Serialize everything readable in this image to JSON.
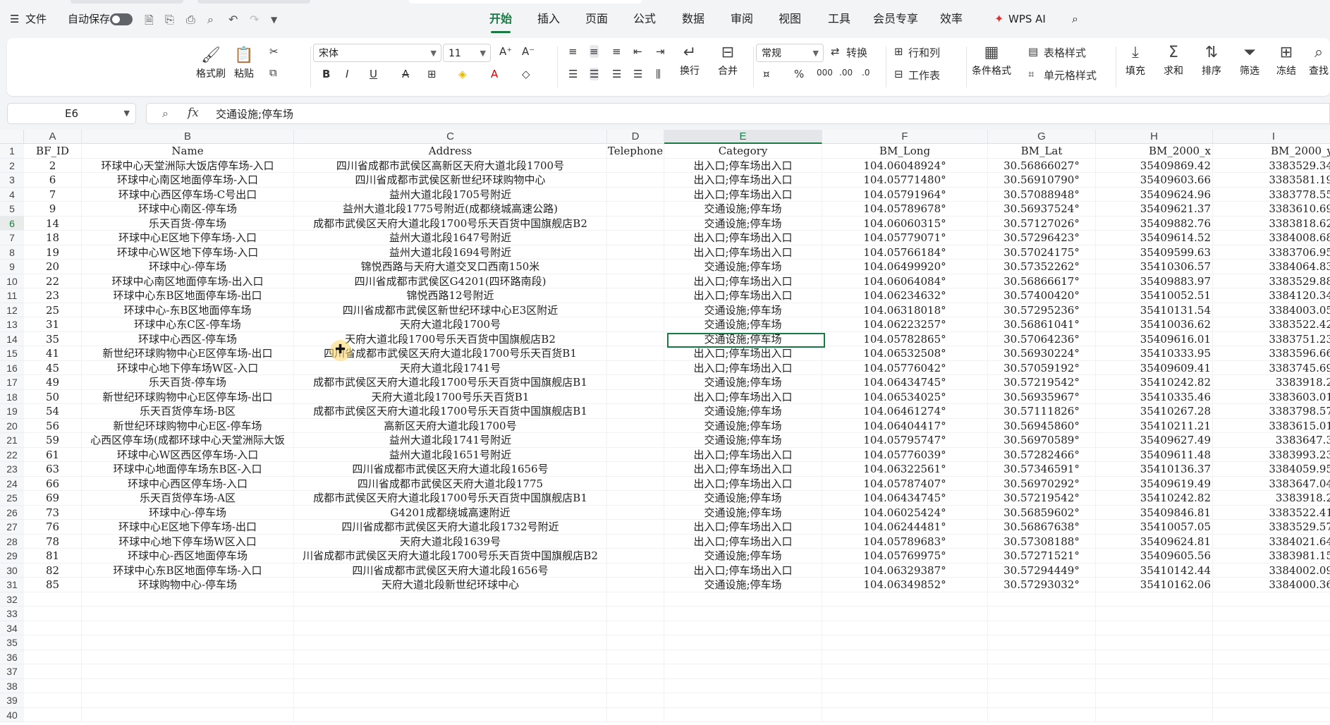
{
  "menubar": {
    "menu_label": "文件",
    "autosave_label": "自动保存",
    "tabs": [
      "开始",
      "插入",
      "页面",
      "公式",
      "数据",
      "审阅",
      "视图",
      "工具",
      "会员专享",
      "效率"
    ],
    "active_tab": "开始",
    "wps_ai": "WPS AI"
  },
  "ribbon": {
    "format_painter": "格式刷",
    "paste": "粘贴",
    "font_name": "宋体",
    "font_size": "11",
    "number_format": "常规",
    "convert": "转换",
    "rows_cols": "行和列",
    "worksheet": "工作表",
    "wrap": "换行",
    "merge": "合并",
    "conditional_format": "条件格式",
    "table_style": "表格样式",
    "cell_style": "单元格样式",
    "fill": "填充",
    "sum": "求和",
    "sort": "排序",
    "filter": "筛选",
    "freeze": "冻结",
    "find": "查找",
    "bold": "B",
    "italic": "I",
    "underline": "U",
    "percent": "%"
  },
  "formula_bar": {
    "cell_ref": "E6",
    "fx": "fx",
    "value": "交通设施;停车场"
  },
  "columns": [
    "A",
    "B",
    "C",
    "D",
    "E",
    "F",
    "G",
    "H",
    "I"
  ],
  "selected_column": "E",
  "selected_row": 6,
  "row_numbers": [
    1,
    2,
    3,
    4,
    5,
    6,
    7,
    8,
    9,
    10,
    11,
    12,
    13,
    14,
    15,
    16,
    17,
    18,
    19,
    20,
    21,
    22,
    23,
    24,
    25,
    26,
    27,
    28,
    29,
    30,
    31,
    32,
    33,
    34,
    35,
    36,
    37,
    38,
    39,
    40
  ],
  "headers": [
    "BF_ID",
    "Name",
    "Address",
    "Telephone",
    "Category",
    "BM_Long",
    "BM_Lat",
    "BM_2000_x",
    "BM_2000_y"
  ],
  "rows": [
    [
      "2",
      "环球中心天堂洲际大饭店停车场-入口",
      "四川省成都市武侯区高新区天府大道北段1700号",
      "",
      "出入口;停车场出入口",
      "104.06048924°",
      "30.56866027°",
      "35409869.42",
      "3383529.34"
    ],
    [
      "6",
      "环球中心南区地面停车场-入口",
      "四川省成都市武侯区新世纪环球购物中心",
      "",
      "出入口;停车场出入口",
      "104.05771480°",
      "30.56910790°",
      "35409603.66",
      "3383581.19"
    ],
    [
      "7",
      "环球中心西区停车场-C号出口",
      "益州大道北段1705号附近",
      "",
      "出入口;停车场出入口",
      "104.05791964°",
      "30.57088948°",
      "35409624.96",
      "3383778.55"
    ],
    [
      "9",
      "环球中心南区-停车场",
      "益州大道北段1775号附近(成都绕城高速公路)",
      "",
      "交通设施;停车场",
      "104.05789678°",
      "30.56937524°",
      "35409621.37",
      "3383610.69"
    ],
    [
      "14",
      "乐天百货-停车场",
      "成都市武侯区天府大道北段1700号乐天百货中国旗舰店B2",
      "",
      "交通设施;停车场",
      "104.06060315°",
      "30.57127026°",
      "35409882.76",
      "3383818.62"
    ],
    [
      "18",
      "环球中心E区地下停车场-入口",
      "益州大道北段1647号附近",
      "",
      "出入口;停车场出入口",
      "104.05779071°",
      "30.57296423°",
      "35409614.52",
      "3384008.68"
    ],
    [
      "19",
      "环球中心W区地下停车场-入口",
      "益州大道北段1694号附近",
      "",
      "出入口;停车场出入口",
      "104.05766184°",
      "30.57024175°",
      "35409599.63",
      "3383706.95"
    ],
    [
      "20",
      "环球中心-停车场",
      "锦悦西路与天府大道交叉口西南150米",
      "",
      "交通设施;停车场",
      "104.06499920°",
      "30.57352262°",
      "35410306.57",
      "3384064.83"
    ],
    [
      "22",
      "环球中心南区地面停车场-出入口",
      "四川省成都市武侯区G4201(四环路南段)",
      "",
      "出入口;停车场出入口",
      "104.06064084°",
      "30.56866617°",
      "35409883.97",
      "3383529.88"
    ],
    [
      "23",
      "环球中心东B区地面停车场-出口",
      "锦悦西路12号附近",
      "",
      "出入口;停车场出入口",
      "104.06234632°",
      "30.57400420°",
      "35410052.51",
      "3384120.34"
    ],
    [
      "25",
      "环球中心-东B区地面停车场",
      "四川省成都市武侯区新世纪环球中心E3区附近",
      "",
      "交通设施;停车场",
      "104.06318018°",
      "30.57295236°",
      "35410131.54",
      "3384003.05"
    ],
    [
      "31",
      "环球中心东C区-停车场",
      "天府大道北段1700号",
      "",
      "交通设施;停车场",
      "104.06223257°",
      "30.56861041°",
      "35410036.62",
      "3383522.42"
    ],
    [
      "35",
      "环球中心西区-停车场",
      "天府大道北段1700号乐天百货中国旗舰店B2",
      "",
      "交通设施;停车场",
      "104.05782865°",
      "30.57064236°",
      "35409616.01",
      "3383751.23"
    ],
    [
      "41",
      "新世纪环球购物中心E区停车场-出口",
      "四川省成都市武侯区天府大道北段1700号乐天百货B1",
      "",
      "出入口;停车场出入口",
      "104.06532508°",
      "30.56930224°",
      "35410333.95",
      "3383596.66"
    ],
    [
      "45",
      "环球中心地下停车场W区-入口",
      "天府大道北段1741号",
      "",
      "出入口;停车场出入口",
      "104.05776042°",
      "30.57059192°",
      "35409609.41",
      "3383745.69"
    ],
    [
      "49",
      "乐天百货-停车场",
      "成都市武侯区天府大道北段1700号乐天百货中国旗舰店B1",
      "",
      "交通设施;停车场",
      "104.06434745°",
      "30.57219542°",
      "35410242.82",
      "3383918.2"
    ],
    [
      "50",
      "新世纪环球购物中心E区停车场-出口",
      "天府大道北段1700号乐天百货B1",
      "",
      "出入口;停车场出入口",
      "104.06534025°",
      "30.56935967°",
      "35410335.46",
      "3383603.01"
    ],
    [
      "54",
      "乐天百货停车场-B区",
      "成都市武侯区天府大道北段1700号乐天百货中国旗舰店B1",
      "",
      "交通设施;停车场",
      "104.06461274°",
      "30.57111826°",
      "35410267.28",
      "3383798.57"
    ],
    [
      "56",
      "新世纪环球购物中心E区-停车场",
      "高新区天府大道北段1700号",
      "",
      "交通设施;停车场",
      "104.06404417°",
      "30.56945860°",
      "35410211.21",
      "3383615.01"
    ],
    [
      "59",
      "心西区停车场(成都环球中心天堂洲际大饭",
      "益州大道北段1741号附近",
      "",
      "交通设施;停车场",
      "104.05795747°",
      "30.56970589°",
      "35409627.49",
      "3383647.3"
    ],
    [
      "61",
      "环球中心W区西区停车场-入口",
      "益州大道北段1651号附近",
      "",
      "出入口;停车场出入口",
      "104.05776039°",
      "30.57282466°",
      "35409611.48",
      "3383993.23"
    ],
    [
      "63",
      "环球中心地面停车场东B区-入口",
      "四川省成都市武侯区天府大道北段1656号",
      "",
      "出入口;停车场出入口",
      "104.06322561°",
      "30.57346591°",
      "35410136.37",
      "3384059.95"
    ],
    [
      "66",
      "环球中心西区停车场-入口",
      "四川省成都市武侯区天府大道北段1775",
      "",
      "出入口;停车场出入口",
      "104.05787407°",
      "30.56970292°",
      "35409619.49",
      "3383647.04"
    ],
    [
      "69",
      "乐天百货停车场-A区",
      "成都市武侯区天府大道北段1700号乐天百货中国旗舰店B1",
      "",
      "交通设施;停车场",
      "104.06434745°",
      "30.57219542°",
      "35410242.82",
      "3383918.2"
    ],
    [
      "73",
      "环球中心-停车场",
      "G4201成都绕城高速附近",
      "",
      "交通设施;停车场",
      "104.06025424°",
      "30.56859602°",
      "35409846.81",
      "3383522.41"
    ],
    [
      "76",
      "环球中心E区地下停车场-出口",
      "四川省成都市武侯区天府大道北段1732号附近",
      "",
      "出入口;停车场出入口",
      "104.06244481°",
      "30.56867638°",
      "35410057.05",
      "3383529.57"
    ],
    [
      "78",
      "环球中心地下停车场W区入口",
      "天府大道北段1639号",
      "",
      "出入口;停车场出入口",
      "104.05789683°",
      "30.57308188°",
      "35409624.81",
      "3384021.64"
    ],
    [
      "81",
      "环球中心-西区地面停车场",
      "川省成都市武侯区天府大道北段1700号乐天百货中国旗舰店B2",
      "",
      "交通设施;停车场",
      "104.05769975°",
      "30.57271521°",
      "35409605.56",
      "3383981.15"
    ],
    [
      "82",
      "环球中心东B区地面停车场-入口",
      "四川省成都市武侯区天府大道北段1656号",
      "",
      "出入口;停车场出入口",
      "104.06329387°",
      "30.57294449°",
      "35410142.44",
      "3384002.09"
    ],
    [
      "85",
      "环球购物中心-停车场",
      "天府大道北段新世纪环球中心",
      "",
      "交通设施;停车场",
      "104.06349852°",
      "30.57293032°",
      "35410162.06",
      "3384000.36"
    ]
  ]
}
